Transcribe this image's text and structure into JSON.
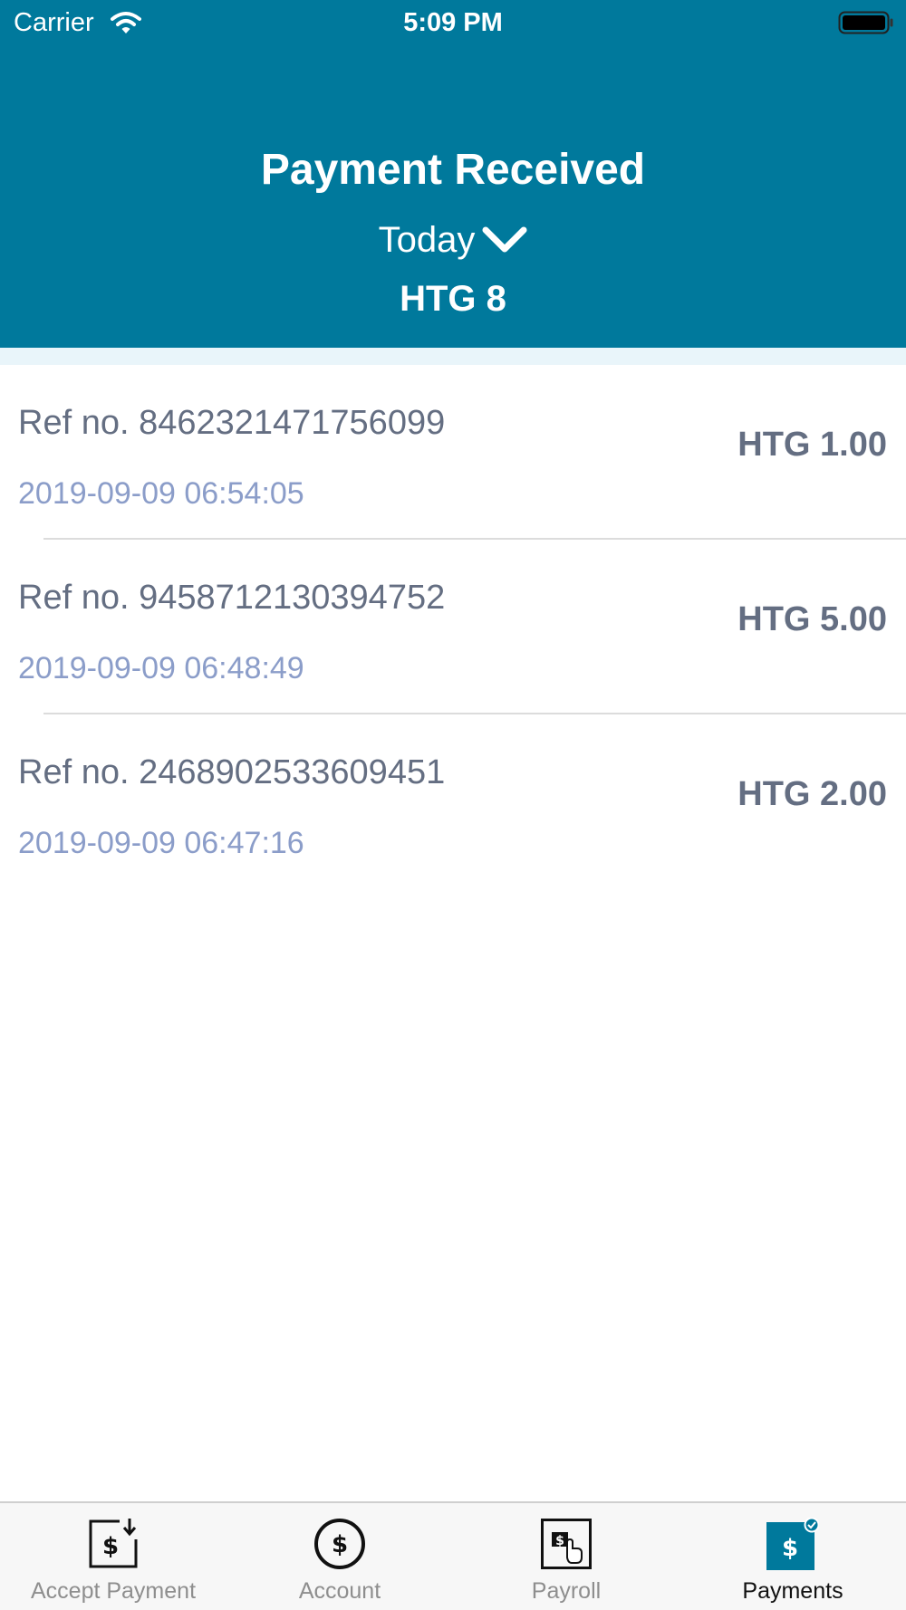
{
  "status_bar": {
    "carrier": "Carrier",
    "time": "5:09 PM"
  },
  "header": {
    "title": "Payment Received",
    "period": "Today",
    "total": "HTG 8",
    "background_color": "#00799c"
  },
  "payments": [
    {
      "ref": "Ref no. 8462321471756099",
      "date": "2019-09-09 06:54:05",
      "amount": "HTG 1.00"
    },
    {
      "ref": "Ref no. 9458712130394752",
      "date": "2019-09-09 06:48:49",
      "amount": "HTG 5.00"
    },
    {
      "ref": "Ref no. 2468902533609451",
      "date": "2019-09-09 06:47:16",
      "amount": "HTG 2.00"
    }
  ],
  "tab_bar": {
    "tabs": [
      {
        "label": "Accept Payment",
        "icon": "accept-payment-icon",
        "active": false
      },
      {
        "label": "Account",
        "icon": "dollar-circle-icon",
        "active": false
      },
      {
        "label": "Payroll",
        "icon": "payroll-icon",
        "active": false
      },
      {
        "label": "Payments",
        "icon": "payments-icon",
        "active": true
      }
    ],
    "active_color": "#00799c"
  }
}
